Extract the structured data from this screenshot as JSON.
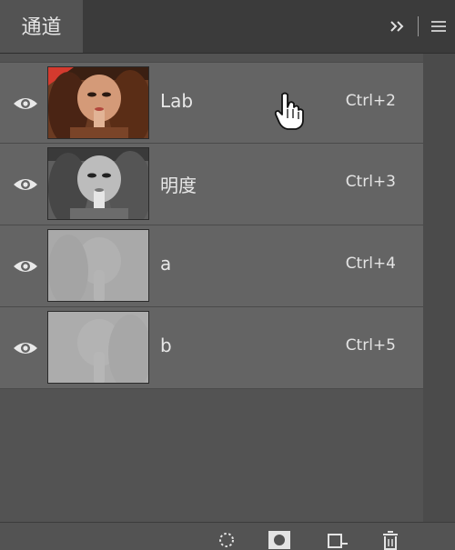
{
  "panel": {
    "tab_title": "通道",
    "icons": {
      "collapse": "double-chevron-right-icon",
      "menu": "hamburger-menu-icon"
    }
  },
  "channels": [
    {
      "name": "Lab",
      "shortcut": "Ctrl+2",
      "thumb": "color",
      "visible": true
    },
    {
      "name": "明度",
      "shortcut": "Ctrl+3",
      "thumb": "grayscale",
      "visible": true
    },
    {
      "name": "a",
      "shortcut": "Ctrl+4",
      "thumb": "flat-gray",
      "visible": true
    },
    {
      "name": "b",
      "shortcut": "Ctrl+5",
      "thumb": "flat-gray",
      "visible": true
    }
  ],
  "footer": {
    "icons": [
      "load-selection-icon",
      "save-selection-icon",
      "new-channel-icon",
      "delete-channel-icon"
    ]
  }
}
